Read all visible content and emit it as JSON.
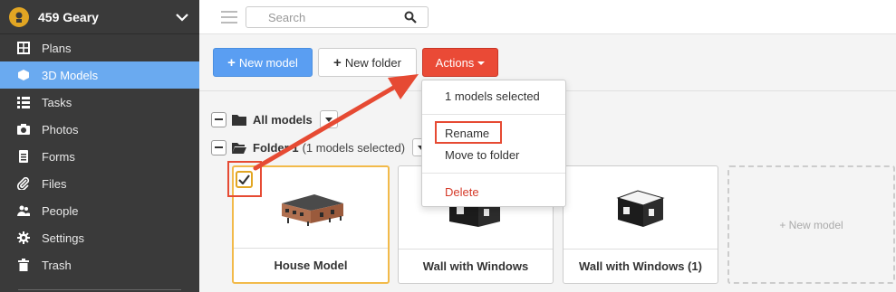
{
  "project": {
    "name": "459 Geary"
  },
  "sidebar": {
    "items": [
      {
        "label": "Plans",
        "icon": "plans-icon",
        "active": false
      },
      {
        "label": "3D Models",
        "icon": "cube-icon",
        "active": true
      },
      {
        "label": "Tasks",
        "icon": "tasks-icon",
        "active": false
      },
      {
        "label": "Photos",
        "icon": "camera-icon",
        "active": false
      },
      {
        "label": "Forms",
        "icon": "forms-icon",
        "active": false
      },
      {
        "label": "Files",
        "icon": "paperclip-icon",
        "active": false
      },
      {
        "label": "People",
        "icon": "people-icon",
        "active": false
      },
      {
        "label": "Settings",
        "icon": "gear-icon",
        "active": false
      },
      {
        "label": "Trash",
        "icon": "trash-icon",
        "active": false
      }
    ]
  },
  "search": {
    "placeholder": "Search",
    "value": ""
  },
  "toolbar": {
    "new_model": "New model",
    "new_folder": "New folder",
    "actions": "Actions"
  },
  "tree": {
    "all_models": "All models",
    "folder": "Folder 1",
    "folder_note": "(1 models selected)"
  },
  "cards": [
    {
      "title": "House Model",
      "selected": true
    },
    {
      "title": "Wall with Windows",
      "selected": false
    },
    {
      "title": "Wall with Windows (1)",
      "selected": false
    }
  ],
  "new_model_tile": "+ New model",
  "menu": {
    "header": "1 models selected",
    "rename": "Rename",
    "move": "Move to folder",
    "delete": "Delete"
  },
  "colors": {
    "sidebar_bg": "#3a3a3a",
    "active_nav": "#6aaaf0",
    "primary": "#5a9ef2",
    "danger": "#ea4a36",
    "highlight": "#e64a33",
    "selected_border": "#f2ba4a"
  }
}
